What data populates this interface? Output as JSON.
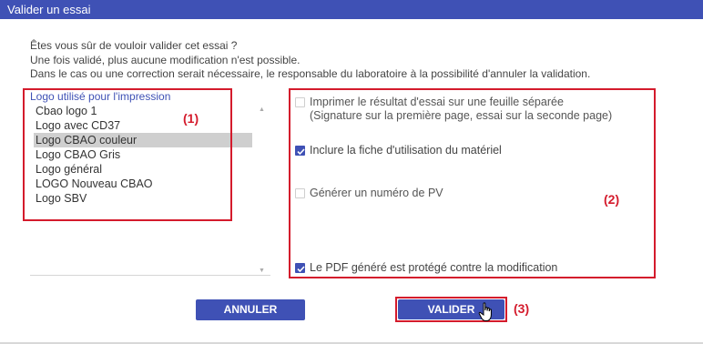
{
  "dialog": {
    "title": "Valider un essai"
  },
  "intro": {
    "line1": "Êtes vous sûr de vouloir valider cet essai ?",
    "line2": "Une fois validé, plus aucune modification n'est possible.",
    "line3": "Dans le cas ou une correction serait nécessaire, le responsable du laboratoire à la possibilité d'annuler la validation."
  },
  "logo_list": {
    "legend": "Logo utilisé pour l'impression",
    "selected": "Logo CBAO couleur",
    "items": [
      "Cbao logo 1",
      "Logo avec CD37",
      "Logo CBAO couleur",
      "Logo CBAO Gris",
      "Logo général",
      "LOGO Nouveau CBAO",
      "Logo SBV"
    ]
  },
  "options": {
    "separate_sheet": {
      "label_line1": "Imprimer le résultat d'essai sur une feuille séparée",
      "label_line2": "(Signature sur la première page, essai sur la seconde page)",
      "checked": false
    },
    "include_equipment_sheet": {
      "label": "Inclure la fiche d'utilisation du matériel",
      "checked": true
    },
    "generate_pv_number": {
      "label": "Générer un numéro de PV",
      "checked": false
    },
    "pdf_protected": {
      "label": "Le PDF généré est protégé contre la modification",
      "checked": true
    }
  },
  "buttons": {
    "cancel": "ANNULER",
    "validate": "VALIDER"
  },
  "annotations": {
    "marker1": "(1)",
    "marker2": "(2)",
    "marker3": "(3)"
  },
  "colors": {
    "accent": "#3f51b5",
    "annotation_red": "#d41b2c",
    "selected_row": "#cfcfcf"
  }
}
